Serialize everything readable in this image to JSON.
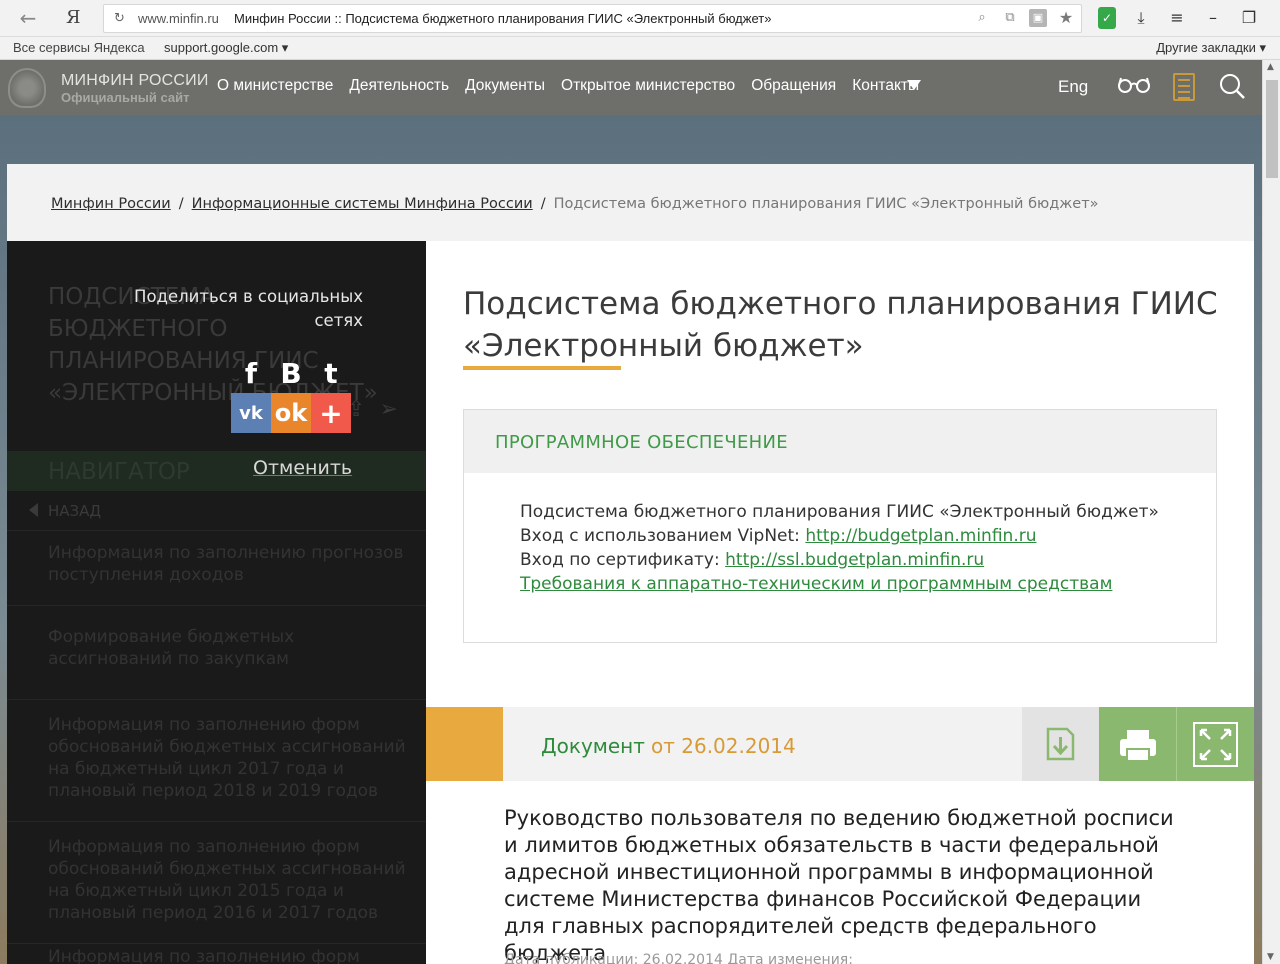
{
  "browser": {
    "logo": "Я",
    "url_domain": "www.minfin.ru",
    "url_title": "Минфин России :: Подсистема бюджетного планирования ГИИС «Электронный бюджет»",
    "bookmarks": {
      "services": "Все сервисы Яндекса",
      "google": "support.google.com ▾",
      "other": "Другие закладки ▾"
    }
  },
  "site": {
    "name": "МИНФИН РОССИИ",
    "subtitle": "Официальный сайт",
    "nav": [
      "О министерстве",
      "Деятельность",
      "Документы",
      "Открытое министерство",
      "Обращения",
      "Контакты"
    ],
    "lang": "Eng"
  },
  "breadcrumb": {
    "items": [
      "Минфин России",
      "Информационные системы Минфина России"
    ],
    "current": "Подсистема бюджетного планирования ГИИС «Электронный бюджет»"
  },
  "sidebar": {
    "title": "ПОДСИСТЕМА БЮДЖЕТНОГО ПЛАНИРОВАНИЯ ГИИС «ЭЛЕКТРОННЫЙ БЮДЖЕТ»",
    "nav_title": "НАВИГАТОР",
    "back": "НАЗАД",
    "items": [
      "Информация по заполнению прогнозов поступления доходов",
      "Формирование бюджетных ассигнований по закупкам",
      "Информация по заполнению форм обоснований бюджетных ассигнований на бюджетный цикл 2017 года и плановый период 2018 и 2019 годов",
      "Информация по заполнению форм обоснований бюджетных ассигнований на бюджетный цикл 2015 года и плановый период 2016 и 2017 годов",
      "Информация по заполнению форм"
    ],
    "share": {
      "caption_line1": "Поделиться в социальных",
      "caption_line2": "сетях",
      "facebook": "f",
      "vkontakte_b": "B",
      "twitter": "t",
      "vk": "vk",
      "ok": "ok",
      "more": "+",
      "cancel": "Отменить"
    }
  },
  "main": {
    "title": "Подсистема бюджетного планирования ГИИС «Электронный бюджет»",
    "software": {
      "heading": "ПРОГРАММНОЕ ОБЕСПЕЧЕНИЕ",
      "line1": "Подсистема бюджетного планирования ГИИС «Электронный бюджет»",
      "line2_prefix": "Вход с использованием VipNet: ",
      "line2_link": "http://budgetplan.minfin.ru",
      "line3_prefix": "Вход по сертификату: ",
      "line3_link": "http://ssl.budgetplan.minfin.ru",
      "line4_link": "Требования к аппаратно-техническим и программным средствам"
    },
    "document": {
      "label": "Документ",
      "date": "от 26.02.2014",
      "heading": "Руководство пользователя по ведению бюджетной росписи и лимитов бюджетных обязательств в части федеральной адресной инвестиционной программы в информационной системе Министерства финансов Российской Федерации для главных распорядителей средств федерального бюджета",
      "meta": "Дата публикации:  26.02.2014   Дата изменения:"
    }
  },
  "colors": {
    "accent_orange": "#e8a93e",
    "green": "#3f9b47",
    "header_gray": "#6e6f6b",
    "button_green": "#8bb86f"
  }
}
